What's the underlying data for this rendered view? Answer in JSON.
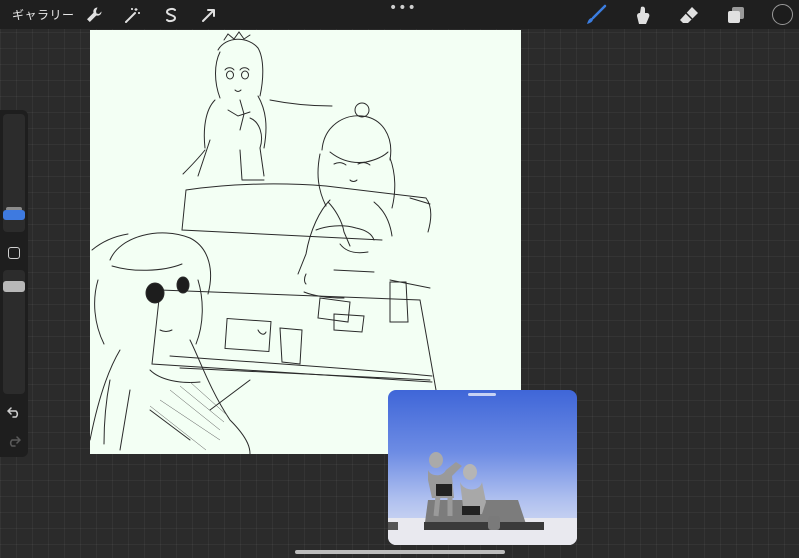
{
  "topbar": {
    "gallery_label": "ギャラリー",
    "left_tools": [
      "wrench-icon",
      "magic-wand-icon",
      "selection-icon",
      "transform-arrow-icon"
    ],
    "more_label": "•••",
    "right_tools": [
      "brush-icon",
      "smudge-icon",
      "eraser-icon",
      "layers-icon"
    ],
    "active_tool": "brush-icon",
    "active_color": "#3b7de0",
    "current_color": "#1c1c1c"
  },
  "sidebar": {
    "brush_size_handle": "size-slider",
    "opacity_handle": "opacity-slider",
    "controls": [
      "modify-button",
      "undo-icon",
      "redo-icon"
    ]
  },
  "canvas": {
    "background": "#f3fff4",
    "content": "line-sketch"
  },
  "reference": {
    "content": "3d-pose-reference"
  }
}
